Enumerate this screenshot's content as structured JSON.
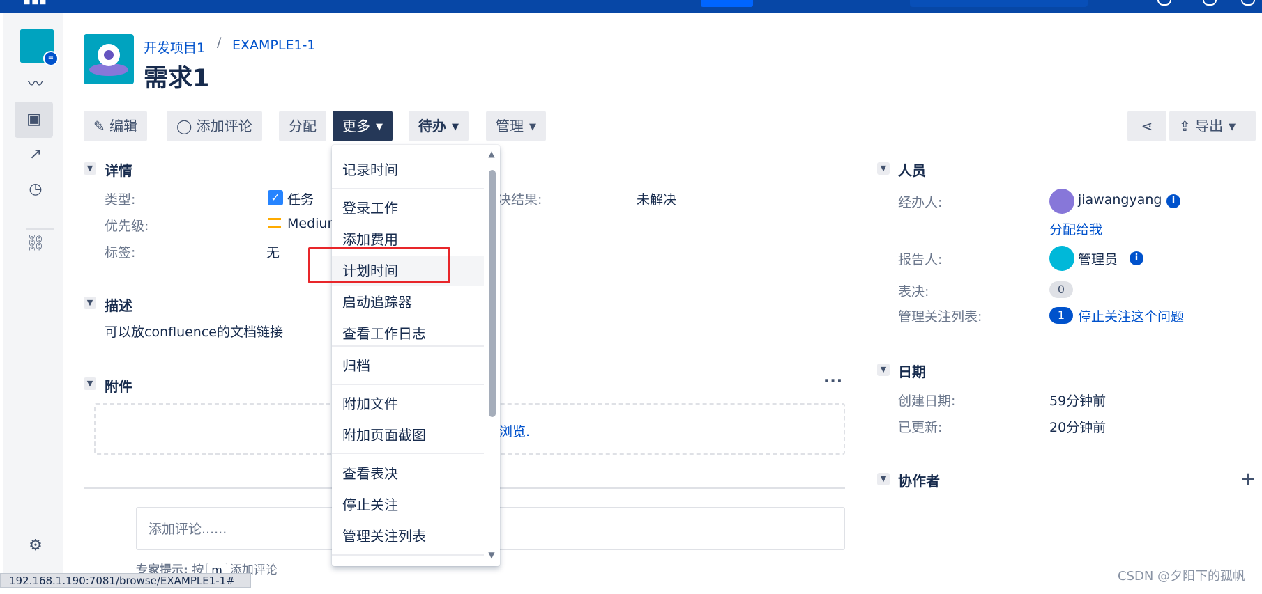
{
  "breadcrumb": {
    "project": "开发项目1",
    "separator": "/",
    "issue_key": "EXAMPLE1-1"
  },
  "issue": {
    "title": "需求1"
  },
  "toolbar": {
    "edit": "编辑",
    "comment": "添加评论",
    "assign": "分配",
    "more": "更多",
    "status": "待办",
    "admin": "管理",
    "export": "导出"
  },
  "dropdown": {
    "items": [
      "记录时间",
      "登录工作",
      "添加费用",
      "计划时间",
      "启动追踪器",
      "查看工作日志",
      "归档",
      "附加文件",
      "附加页面截图",
      "查看表决",
      "停止关注",
      "管理关注列表"
    ],
    "highlighted": "计划时间"
  },
  "details": {
    "title": "详情",
    "type_label": "类型:",
    "type_value": "任务",
    "priority_label": "优先级:",
    "priority_value": "Medium",
    "labels_label": "标签:",
    "labels_value": "无",
    "resolution_label": "解决结果:",
    "resolution_visible": "决结果:",
    "resolution_value": "未解决"
  },
  "description": {
    "title": "描述",
    "text": "可以放confluence的文档链接"
  },
  "attachments": {
    "title": "附件",
    "drop_text_visible": "浏览.",
    "more": "···"
  },
  "comment": {
    "placeholder": "添加评论......",
    "hint_prefix": "专家提示:",
    "hint_press": "按",
    "hint_key": "m",
    "hint_suffix": "添加评论"
  },
  "people": {
    "title": "人员",
    "assignee_label": "经办人:",
    "assignee": "jiawangyang",
    "assign_to_me": "分配给我",
    "reporter_label": "报告人:",
    "reporter": "管理员",
    "votes_label": "表决:",
    "votes": "0",
    "watchers_label": "管理关注列表:",
    "watchers_count": "1",
    "stop_watching": "停止关注这个问题"
  },
  "dates": {
    "title": "日期",
    "created_label": "创建日期:",
    "created": "59分钟前",
    "updated_label": "已更新:",
    "updated": "20分钟前"
  },
  "collaborators": {
    "title": "协作者",
    "add": "+"
  },
  "status_url": "192.168.1.190:7081/browse/EXAMPLE1-1#",
  "watermark": "CSDN @夕阳下的孤帆",
  "colors": {
    "topbar": "#0747a6",
    "link": "#0052cc",
    "highlight_box": "#e8262a",
    "more_button": "#253858"
  }
}
